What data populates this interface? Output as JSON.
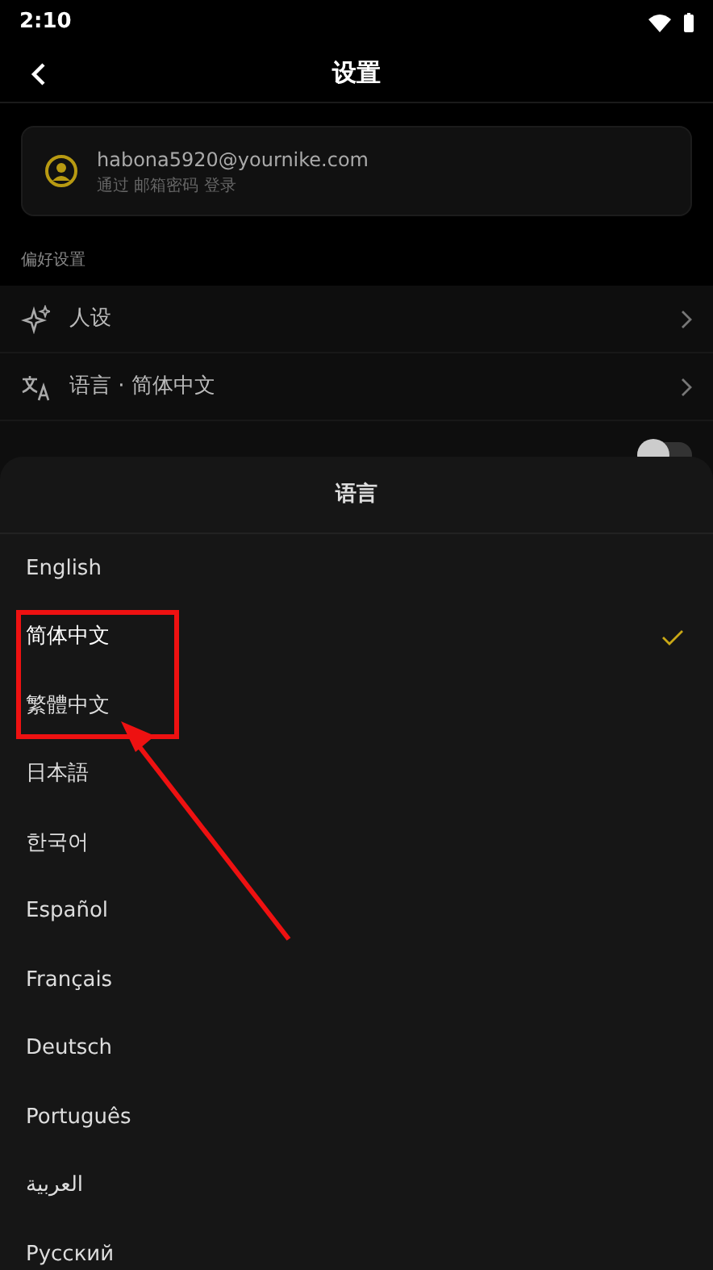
{
  "status_bar": {
    "time": "2:10"
  },
  "header": {
    "title": "设置"
  },
  "account": {
    "email": "habona5920@yournike.com",
    "login_method": "通过 邮箱密码 登录"
  },
  "section_title": "偏好设置",
  "settings": [
    {
      "kind": "link",
      "label": "人设"
    },
    {
      "kind": "link",
      "label": "语言 · 简体中文"
    },
    {
      "kind": "toggle",
      "on": false
    }
  ],
  "language_sheet": {
    "title": "语言",
    "options": [
      {
        "label": "English",
        "selected": false
      },
      {
        "label": "简体中文",
        "selected": true
      },
      {
        "label": "繁體中文",
        "selected": false
      },
      {
        "label": "日本語",
        "selected": false
      },
      {
        "label": "한국어",
        "selected": false
      },
      {
        "label": "Español",
        "selected": false
      },
      {
        "label": "Français",
        "selected": false
      },
      {
        "label": "Deutsch",
        "selected": false
      },
      {
        "label": "Português",
        "selected": false
      },
      {
        "label": "العربية",
        "selected": false
      },
      {
        "label": "Русский",
        "selected": false
      }
    ]
  }
}
